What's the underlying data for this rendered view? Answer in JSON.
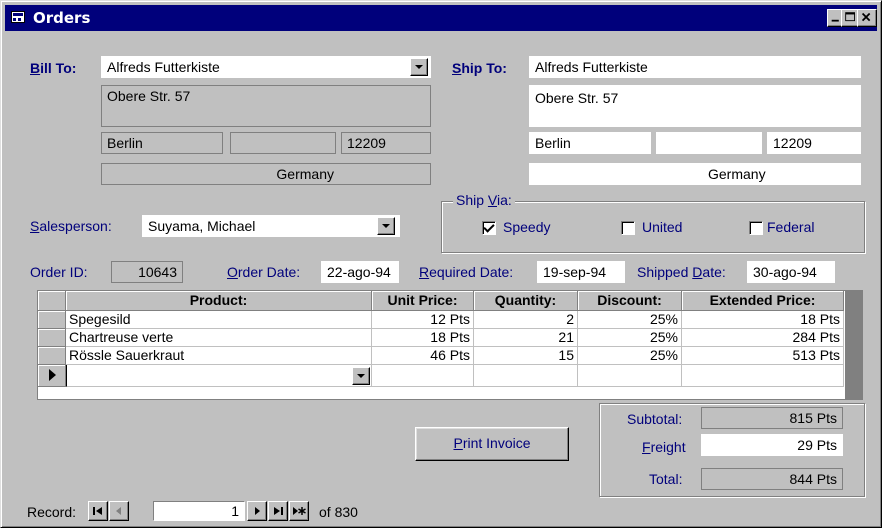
{
  "window": {
    "title": "Orders"
  },
  "bill_to": {
    "label_prefix": "B",
    "label_rest": "ill To:",
    "name": "Alfreds Futterkiste",
    "address": "Obere Str. 57",
    "city": "Berlin",
    "region": "",
    "postal": "12209",
    "country": "Germany"
  },
  "ship_to": {
    "label_prefix": "S",
    "label_rest": "hip To:",
    "name": "Alfreds Futterkiste",
    "address": "Obere Str. 57",
    "city": "Berlin",
    "region": "",
    "postal": "12209",
    "country": "Germany"
  },
  "salesperson": {
    "label_prefix": "S",
    "label_rest": "alesperson:",
    "value": "Suyama, Michael"
  },
  "ship_via": {
    "label_pre": "Ship ",
    "label_acc": "V",
    "label_post": "ia:",
    "options": [
      {
        "label": "Speedy",
        "checked": true
      },
      {
        "label": "United",
        "checked": false
      },
      {
        "label": "Federal",
        "checked": false
      }
    ]
  },
  "order": {
    "id_label": "Order ID:",
    "id": "10643",
    "order_date_acc": "O",
    "order_date_rest": "rder Date:",
    "order_date": "22-ago-94",
    "required_acc": "R",
    "required_rest": "equired Date:",
    "required_date": "19-sep-94",
    "shipped_pre": "Shipped ",
    "shipped_acc": "D",
    "shipped_rest": "ate:",
    "shipped_date": "30-ago-94"
  },
  "grid": {
    "headers": [
      "Product:",
      "Unit Price:",
      "Quantity:",
      "Discount:",
      "Extended Price:"
    ],
    "rows": [
      [
        "Spegesild",
        "12 Pts",
        "2",
        "25%",
        "18 Pts"
      ],
      [
        "Chartreuse verte",
        "18 Pts",
        "21",
        "25%",
        "284 Pts"
      ],
      [
        "Rössle Sauerkraut",
        "46 Pts",
        "15",
        "25%",
        "513 Pts"
      ]
    ]
  },
  "print_button": {
    "acc": "P",
    "rest": "rint Invoice"
  },
  "totals": {
    "subtotal_label": "Subtotal:",
    "subtotal": "815 Pts",
    "freight_acc": "F",
    "freight_rest": "reight",
    "freight": "29 Pts",
    "total_label": "Total:",
    "total": "844 Pts"
  },
  "nav": {
    "label": "Record:",
    "current": "1",
    "of_text": "of 830"
  }
}
